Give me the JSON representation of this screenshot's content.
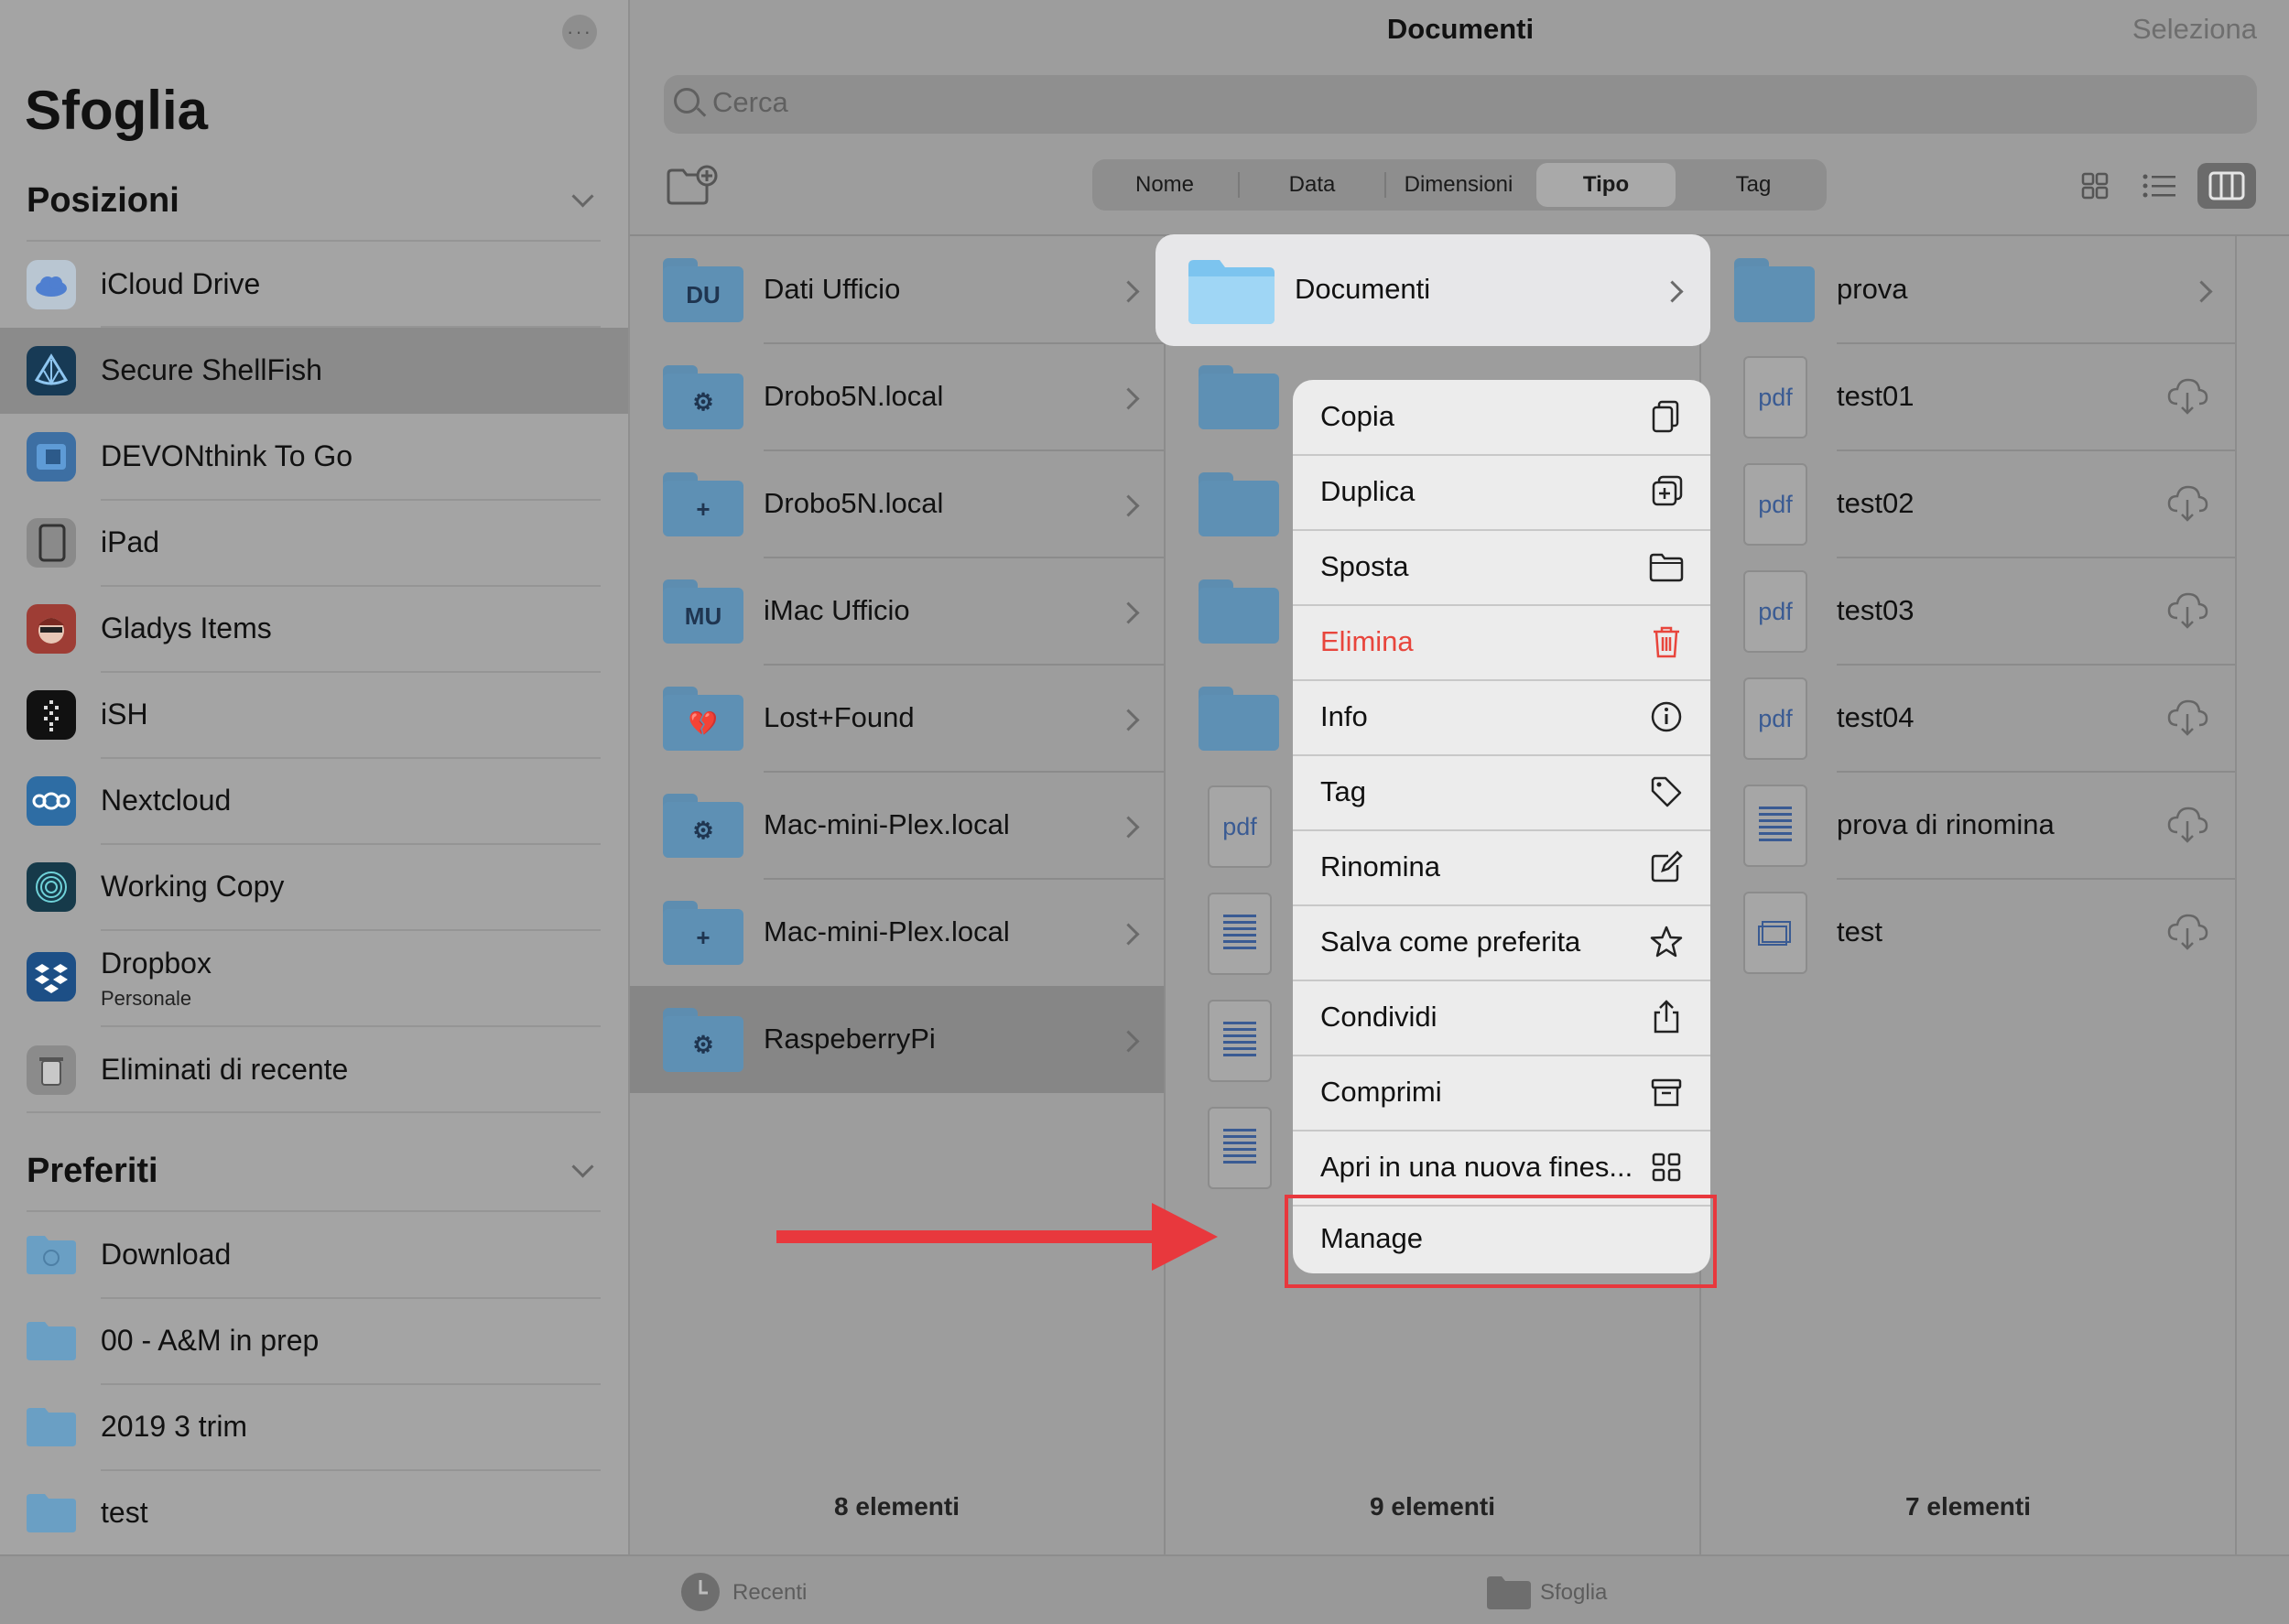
{
  "sidebar": {
    "title": "Sfoglia",
    "more_icon": "ellipsis-icon",
    "sections": {
      "positions": "Posizioni",
      "favorites": "Preferiti"
    },
    "locations": [
      {
        "label": "iCloud Drive",
        "icon": "icloud-icon"
      },
      {
        "label": "Secure ShellFish",
        "icon": "shellfish-icon",
        "selected": true
      },
      {
        "label": "DEVONthink To Go",
        "icon": "devonthink-icon"
      },
      {
        "label": "iPad",
        "icon": "ipad-icon"
      },
      {
        "label": "Gladys Items",
        "icon": "gladys-icon"
      },
      {
        "label": "iSH",
        "icon": "ish-icon"
      },
      {
        "label": "Nextcloud",
        "icon": "nextcloud-icon"
      },
      {
        "label": "Working Copy",
        "icon": "working-copy-icon"
      },
      {
        "label": "Dropbox",
        "sublabel": "Personale",
        "icon": "dropbox-icon"
      },
      {
        "label": "Eliminati di recente",
        "icon": "trash-icon"
      }
    ],
    "favorites": [
      {
        "label": "Download",
        "icon": "download-folder-icon"
      },
      {
        "label": "00 - A&M in prep",
        "icon": "folder-icon"
      },
      {
        "label": "2019 3 trim",
        "icon": "folder-icon"
      },
      {
        "label": "test",
        "icon": "folder-icon"
      }
    ]
  },
  "header": {
    "title": "Documenti",
    "select_label": "Seleziona",
    "search_placeholder": "Cerca"
  },
  "sort": {
    "options": [
      "Nome",
      "Data",
      "Dimensioni",
      "Tipo",
      "Tag"
    ],
    "active": "Tipo"
  },
  "columns": {
    "col1": {
      "items": [
        {
          "label": "Dati Ufficio",
          "glyph": "DU"
        },
        {
          "label": "Drobo5N.local",
          "glyph": "⚙"
        },
        {
          "label": "Drobo5N.local",
          "glyph": "+"
        },
        {
          "label": "iMac Ufficio",
          "glyph": "MU"
        },
        {
          "label": "Lost+Found",
          "glyph": "💔"
        },
        {
          "label": "Mac-mini-Plex.local",
          "glyph": "⚙"
        },
        {
          "label": "Mac-mini-Plex.local",
          "glyph": "+"
        },
        {
          "label": "RaspeberryPi",
          "glyph": "⚙",
          "selected": true
        }
      ],
      "count": "8 elementi"
    },
    "col2": {
      "highlighted": "Documenti",
      "count": "9 elementi",
      "pdf_label": "pdf"
    },
    "col3": {
      "items": [
        {
          "label": "prova",
          "kind": "folder"
        },
        {
          "label": "test01",
          "kind": "pdf",
          "thumb": "pdf"
        },
        {
          "label": "test02",
          "kind": "pdf",
          "thumb": "pdf"
        },
        {
          "label": "test03",
          "kind": "pdf",
          "thumb": "pdf"
        },
        {
          "label": "test04",
          "kind": "pdf",
          "thumb": "pdf"
        },
        {
          "label": "prova di rinomina",
          "kind": "text"
        },
        {
          "label": "test",
          "kind": "window"
        }
      ],
      "count": "7 elementi"
    }
  },
  "context_menu": {
    "items": [
      {
        "label": "Copia",
        "icon": "copy-icon"
      },
      {
        "label": "Duplica",
        "icon": "duplicate-icon"
      },
      {
        "label": "Sposta",
        "icon": "folder-move-icon"
      },
      {
        "label": "Elimina",
        "icon": "trash-icon",
        "destructive": true
      },
      {
        "label": "Info",
        "icon": "info-icon"
      },
      {
        "label": "Tag",
        "icon": "tag-icon"
      },
      {
        "label": "Rinomina",
        "icon": "rename-icon"
      },
      {
        "label": "Salva come preferita",
        "icon": "star-icon"
      },
      {
        "label": "Condividi",
        "icon": "share-icon"
      },
      {
        "label": "Comprimi",
        "icon": "archive-icon"
      },
      {
        "label": "Apri in una nuova fines...",
        "icon": "grid-icon"
      },
      {
        "label": "Manage",
        "icon": ""
      }
    ]
  },
  "annotation": {
    "color": "#e8383d"
  },
  "tabbar": {
    "recent": "Recenti",
    "browse": "Sfoglia"
  }
}
